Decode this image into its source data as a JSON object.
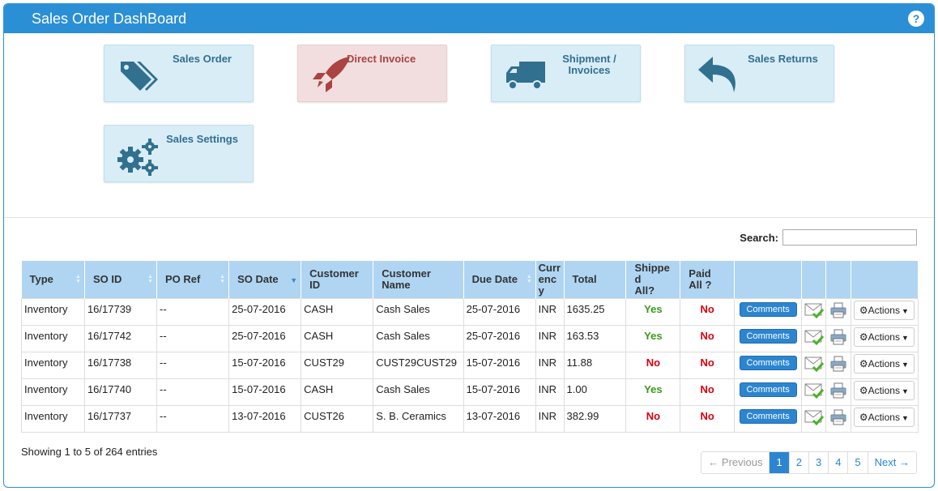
{
  "header": {
    "title": "Sales Order DashBoard",
    "help_icon": "?"
  },
  "tiles": [
    {
      "label": "Sales Order",
      "icon": "tags-icon"
    },
    {
      "label": "Direct Invoice",
      "icon": "rocket-icon"
    },
    {
      "label": "Shipment / Invoices",
      "icon": "truck-icon"
    },
    {
      "label": "Sales Returns",
      "icon": "reply-arrow-icon"
    },
    {
      "label": "Sales Settings",
      "icon": "gears-icon"
    }
  ],
  "search": {
    "label": "Search:",
    "value": ""
  },
  "table": {
    "columns": [
      "Type",
      "SO ID",
      "PO Ref",
      "SO Date",
      "Customer ID",
      "Customer Name",
      "Due Date",
      "Currency",
      "Total",
      "Shipped All?",
      "Paid All ?"
    ],
    "column_display": {
      "customer_id": [
        "Customer",
        "ID"
      ],
      "customer_name": [
        "Customer",
        "Name"
      ],
      "currency": [
        "Curr",
        "enc",
        "y"
      ],
      "shipped": [
        "Shippe",
        "d",
        "All?"
      ],
      "paid": [
        "Paid",
        "All ?"
      ]
    },
    "comments_label": "Comments",
    "actions_label": "Actions",
    "rows": [
      {
        "type": "Inventory",
        "so_id": "16/17739",
        "po_ref": "--",
        "so_date": "25-07-2016",
        "customer_id": "CASH",
        "customer_name": "Cash Sales",
        "due_date": "25-07-2016",
        "currency": "INR",
        "total": "1635.25",
        "shipped": "Yes",
        "paid": "No"
      },
      {
        "type": "Inventory",
        "so_id": "16/17742",
        "po_ref": "--",
        "so_date": "25-07-2016",
        "customer_id": "CASH",
        "customer_name": "Cash Sales",
        "due_date": "25-07-2016",
        "currency": "INR",
        "total": "163.53",
        "shipped": "Yes",
        "paid": "No"
      },
      {
        "type": "Inventory",
        "so_id": "16/17738",
        "po_ref": "--",
        "so_date": "15-07-2016",
        "customer_id": "CUST29",
        "customer_name": "CUST29CUST29",
        "due_date": "15-07-2016",
        "currency": "INR",
        "total": "11.88",
        "shipped": "No",
        "paid": "No"
      },
      {
        "type": "Inventory",
        "so_id": "16/17740",
        "po_ref": "--",
        "so_date": "15-07-2016",
        "customer_id": "CASH",
        "customer_name": "Cash Sales",
        "due_date": "15-07-2016",
        "currency": "INR",
        "total": "1.00",
        "shipped": "Yes",
        "paid": "No"
      },
      {
        "type": "Inventory",
        "so_id": "16/17737",
        "po_ref": "--",
        "so_date": "13-07-2016",
        "customer_id": "CUST26",
        "customer_name": "S. B. Ceramics",
        "due_date": "13-07-2016",
        "currency": "INR",
        "total": "382.99",
        "shipped": "No",
        "paid": "No"
      }
    ]
  },
  "footer": {
    "info": "Showing 1 to 5 of 264 entries"
  },
  "pagination": {
    "previous": "← Previous",
    "pages": [
      "1",
      "2",
      "3",
      "4",
      "5"
    ],
    "active": "1",
    "next": "Next →"
  },
  "colors": {
    "header_blue": "#2b8fd6",
    "tile_blue": "#d9edf7",
    "tile_red": "#f2dede",
    "th_blue": "#afd5f3",
    "yes": "#3c9a1c",
    "no": "#d9000d"
  }
}
